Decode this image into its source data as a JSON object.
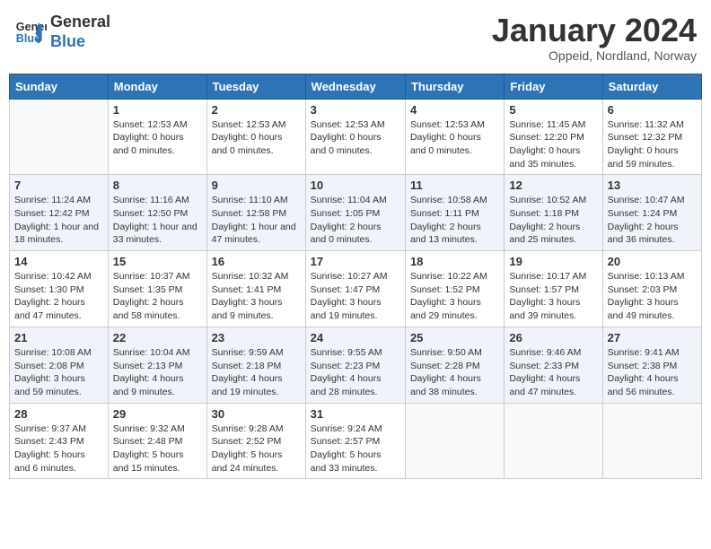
{
  "header": {
    "logo_line1": "General",
    "logo_line2": "Blue",
    "month_title": "January 2024",
    "subtitle": "Oppeid, Nordland, Norway"
  },
  "weekdays": [
    "Sunday",
    "Monday",
    "Tuesday",
    "Wednesday",
    "Thursday",
    "Friday",
    "Saturday"
  ],
  "weeks": [
    [
      {
        "day": "",
        "info": ""
      },
      {
        "day": "1",
        "info": "Sunset: 12:53 AM\nDaylight: 0 hours\nand 0 minutes."
      },
      {
        "day": "2",
        "info": "Sunset: 12:53 AM\nDaylight: 0 hours\nand 0 minutes."
      },
      {
        "day": "3",
        "info": "Sunset: 12:53 AM\nDaylight: 0 hours\nand 0 minutes."
      },
      {
        "day": "4",
        "info": "Sunset: 12:53 AM\nDaylight: 0 hours\nand 0 minutes."
      },
      {
        "day": "5",
        "info": "Sunrise: 11:45 AM\nSunset: 12:20 PM\nDaylight: 0 hours\nand 35 minutes."
      },
      {
        "day": "6",
        "info": "Sunrise: 11:32 AM\nSunset: 12:32 PM\nDaylight: 0 hours\nand 59 minutes."
      }
    ],
    [
      {
        "day": "7",
        "info": "Sunrise: 11:24 AM\nSunset: 12:42 PM\nDaylight: 1 hour and\n18 minutes."
      },
      {
        "day": "8",
        "info": "Sunrise: 11:16 AM\nSunset: 12:50 PM\nDaylight: 1 hour and\n33 minutes."
      },
      {
        "day": "9",
        "info": "Sunrise: 11:10 AM\nSunset: 12:58 PM\nDaylight: 1 hour and\n47 minutes."
      },
      {
        "day": "10",
        "info": "Sunrise: 11:04 AM\nSunset: 1:05 PM\nDaylight: 2 hours\nand 0 minutes."
      },
      {
        "day": "11",
        "info": "Sunrise: 10:58 AM\nSunset: 1:11 PM\nDaylight: 2 hours\nand 13 minutes."
      },
      {
        "day": "12",
        "info": "Sunrise: 10:52 AM\nSunset: 1:18 PM\nDaylight: 2 hours\nand 25 minutes."
      },
      {
        "day": "13",
        "info": "Sunrise: 10:47 AM\nSunset: 1:24 PM\nDaylight: 2 hours\nand 36 minutes."
      }
    ],
    [
      {
        "day": "14",
        "info": "Sunrise: 10:42 AM\nSunset: 1:30 PM\nDaylight: 2 hours\nand 47 minutes."
      },
      {
        "day": "15",
        "info": "Sunrise: 10:37 AM\nSunset: 1:35 PM\nDaylight: 2 hours\nand 58 minutes."
      },
      {
        "day": "16",
        "info": "Sunrise: 10:32 AM\nSunset: 1:41 PM\nDaylight: 3 hours\nand 9 minutes."
      },
      {
        "day": "17",
        "info": "Sunrise: 10:27 AM\nSunset: 1:47 PM\nDaylight: 3 hours\nand 19 minutes."
      },
      {
        "day": "18",
        "info": "Sunrise: 10:22 AM\nSunset: 1:52 PM\nDaylight: 3 hours\nand 29 minutes."
      },
      {
        "day": "19",
        "info": "Sunrise: 10:17 AM\nSunset: 1:57 PM\nDaylight: 3 hours\nand 39 minutes."
      },
      {
        "day": "20",
        "info": "Sunrise: 10:13 AM\nSunset: 2:03 PM\nDaylight: 3 hours\nand 49 minutes."
      }
    ],
    [
      {
        "day": "21",
        "info": "Sunrise: 10:08 AM\nSunset: 2:08 PM\nDaylight: 3 hours\nand 59 minutes."
      },
      {
        "day": "22",
        "info": "Sunrise: 10:04 AM\nSunset: 2:13 PM\nDaylight: 4 hours\nand 9 minutes."
      },
      {
        "day": "23",
        "info": "Sunrise: 9:59 AM\nSunset: 2:18 PM\nDaylight: 4 hours\nand 19 minutes."
      },
      {
        "day": "24",
        "info": "Sunrise: 9:55 AM\nSunset: 2:23 PM\nDaylight: 4 hours\nand 28 minutes."
      },
      {
        "day": "25",
        "info": "Sunrise: 9:50 AM\nSunset: 2:28 PM\nDaylight: 4 hours\nand 38 minutes."
      },
      {
        "day": "26",
        "info": "Sunrise: 9:46 AM\nSunset: 2:33 PM\nDaylight: 4 hours\nand 47 minutes."
      },
      {
        "day": "27",
        "info": "Sunrise: 9:41 AM\nSunset: 2:38 PM\nDaylight: 4 hours\nand 56 minutes."
      }
    ],
    [
      {
        "day": "28",
        "info": "Sunrise: 9:37 AM\nSunset: 2:43 PM\nDaylight: 5 hours\nand 6 minutes."
      },
      {
        "day": "29",
        "info": "Sunrise: 9:32 AM\nSunset: 2:48 PM\nDaylight: 5 hours\nand 15 minutes."
      },
      {
        "day": "30",
        "info": "Sunrise: 9:28 AM\nSunset: 2:52 PM\nDaylight: 5 hours\nand 24 minutes."
      },
      {
        "day": "31",
        "info": "Sunrise: 9:24 AM\nSunset: 2:57 PM\nDaylight: 5 hours\nand 33 minutes."
      },
      {
        "day": "",
        "info": ""
      },
      {
        "day": "",
        "info": ""
      },
      {
        "day": "",
        "info": ""
      }
    ]
  ]
}
